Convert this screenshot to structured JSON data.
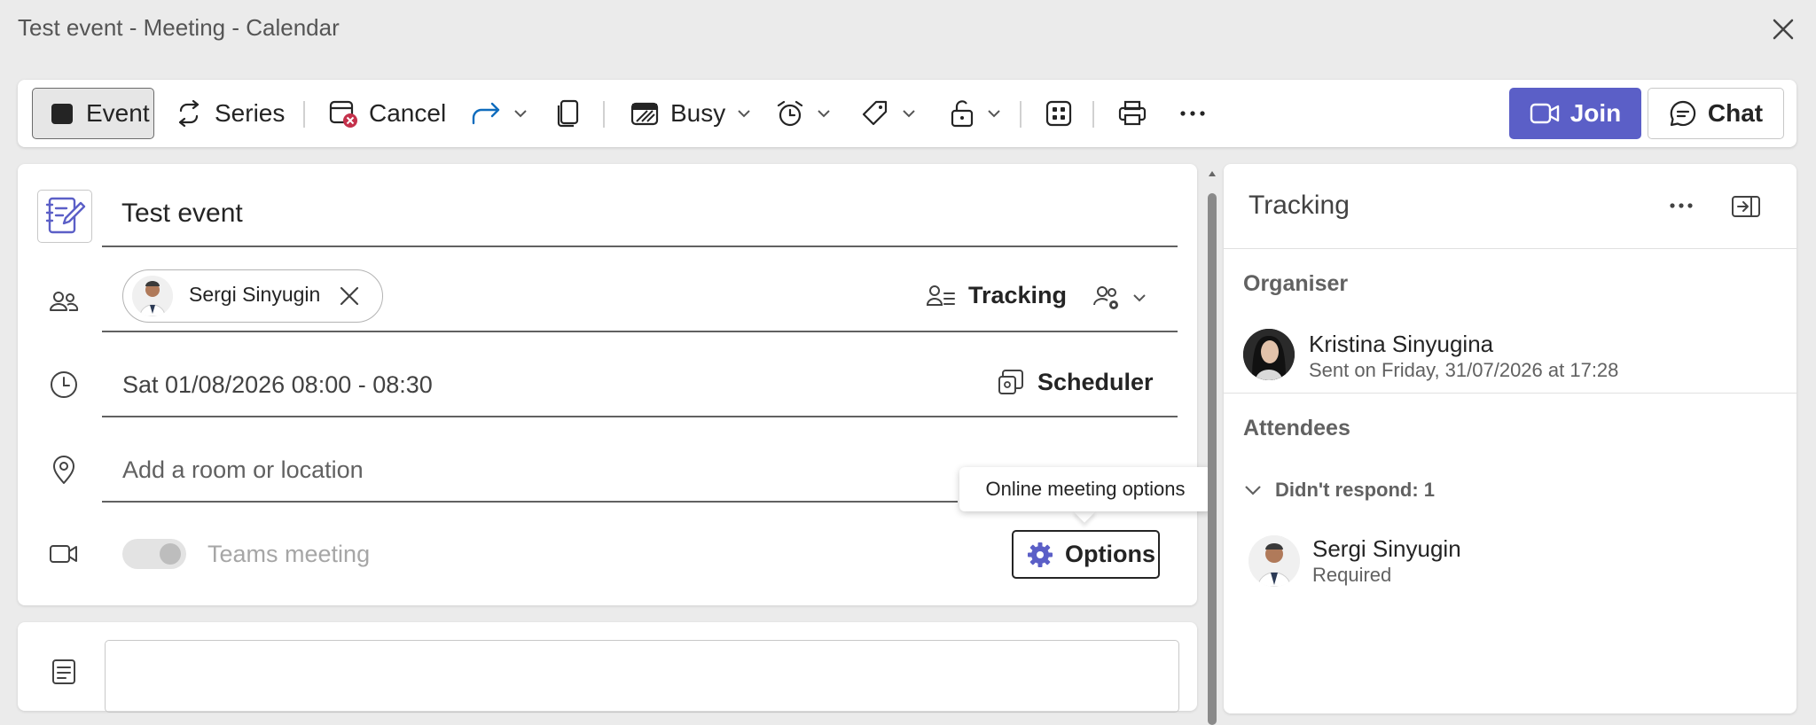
{
  "window": {
    "title": "Test event - Meeting - Calendar"
  },
  "toolbar": {
    "event_label": "Event",
    "series_label": "Series",
    "cancel_label": "Cancel",
    "busy_label": "Busy",
    "join_label": "Join",
    "chat_label": "Chat"
  },
  "form": {
    "title_value": "Test event",
    "attendee_chip": "Sergi Sinyugin",
    "tracking_label": "Tracking",
    "datetime_value": "Sat 01/08/2026 08:00 - 08:30",
    "scheduler_label": "Scheduler",
    "location_placeholder": "Add a room or location",
    "teams_label": "Teams meeting",
    "teams_enabled": false,
    "options_label": "Options",
    "options_tooltip": "Online meeting options"
  },
  "panel": {
    "title": "Tracking",
    "organiser_heading": "Organiser",
    "organiser_name": "Kristina Sinyugina",
    "organiser_sent": "Sent on Friday, 31/07/2026 at 17:28",
    "attendees_heading": "Attendees",
    "didnt_respond": "Didn't respond: 1",
    "attendee_name": "Sergi Sinyugin",
    "attendee_role": "Required"
  },
  "colors": {
    "accent": "#5b5fc7",
    "cancel_red": "#c4314b",
    "forward_blue": "#0f6cbd"
  }
}
